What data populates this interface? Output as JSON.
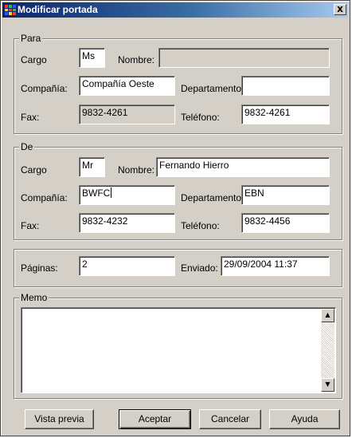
{
  "window": {
    "title": "Modificar portada",
    "close_label": "x"
  },
  "para": {
    "legend": "Para",
    "cargo_label": "Cargo",
    "cargo_value": "Ms",
    "nombre_label": "Nombre:",
    "nombre_value": "",
    "compania_label": "Compañía:",
    "compania_value": "Compañía Oeste",
    "departamento_label": "Departamento",
    "departamento_value": "",
    "fax_label": "Fax:",
    "fax_value": "9832-4261",
    "telefono_label": "Teléfono:",
    "telefono_value": "9832-4261"
  },
  "de": {
    "legend": "De",
    "cargo_label": "Cargo",
    "cargo_value": "Mr",
    "nombre_label": "Nombre:",
    "nombre_value": "Fernando Hierro",
    "compania_label": "Compañía:",
    "compania_value": "BWFC",
    "departamento_label": "Departamento",
    "departamento_value": "EBN",
    "fax_label": "Fax:",
    "fax_value": "9832-4232",
    "telefono_label": "Teléfono:",
    "telefono_value": "9832-4456"
  },
  "envio": {
    "paginas_label": "Páginas:",
    "paginas_value": "2",
    "enviado_label": "Enviado:",
    "enviado_value": "29/09/2004 11:37"
  },
  "memo": {
    "legend": "Memo",
    "value": ""
  },
  "buttons": {
    "preview": "Vista previa",
    "accept": "Aceptar",
    "cancel": "Cancelar",
    "help": "Ayuda"
  }
}
